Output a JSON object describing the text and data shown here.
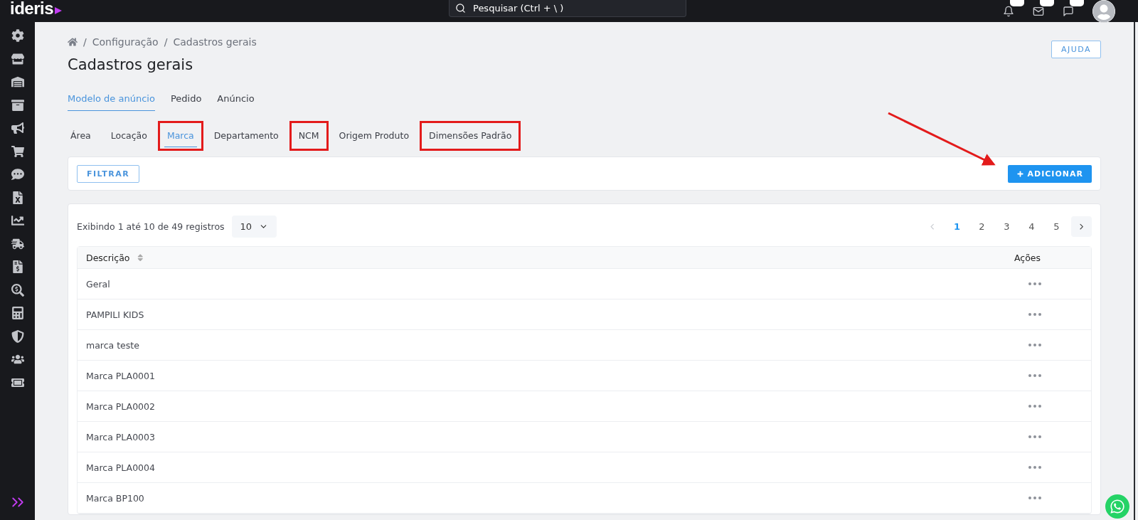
{
  "topbar": {
    "logo": "ideris",
    "search": {
      "placeholder": "Pesquisar (Ctrl + \\ )"
    }
  },
  "breadcrumb": [
    {
      "separator": "/",
      "label": "Configuração"
    },
    {
      "separator": "/",
      "label": "Cadastros gerais"
    }
  ],
  "page_title": "Cadastros gerais",
  "help_button": "AJUDA",
  "tabs": [
    {
      "label": "Modelo de anúncio",
      "selected": true
    },
    {
      "label": "Pedido",
      "selected": false
    },
    {
      "label": "Anúncio",
      "selected": false
    }
  ],
  "subtabs": [
    {
      "label": "Área",
      "selected": false,
      "highlighted": false
    },
    {
      "label": "Locação",
      "selected": false,
      "highlighted": false
    },
    {
      "label": "Marca",
      "selected": true,
      "highlighted": true
    },
    {
      "label": "Departamento",
      "selected": false,
      "highlighted": false
    },
    {
      "label": "NCM",
      "selected": false,
      "highlighted": true
    },
    {
      "label": "Origem Produto",
      "selected": false,
      "highlighted": false
    },
    {
      "label": "Dimensões Padrão",
      "selected": false,
      "highlighted": true
    }
  ],
  "filter_button": "FILTRAR",
  "add_button": "ADICIONAR",
  "records_info": "Exibindo 1 até 10 de 49 registros",
  "page_size": "10",
  "pages": [
    {
      "label": "1",
      "selected": true
    },
    {
      "label": "2",
      "selected": false
    },
    {
      "label": "3",
      "selected": false
    },
    {
      "label": "4",
      "selected": false
    },
    {
      "label": "5",
      "selected": false
    }
  ],
  "table": {
    "columns": [
      "Descrição",
      "Ações"
    ],
    "rows": [
      "Geral",
      "PAMPILI KIDS",
      "marca teste",
      "Marca PLA0001",
      "Marca PLA0002",
      "Marca PLA0003",
      "Marca PLA0004",
      "Marca BP100"
    ]
  }
}
